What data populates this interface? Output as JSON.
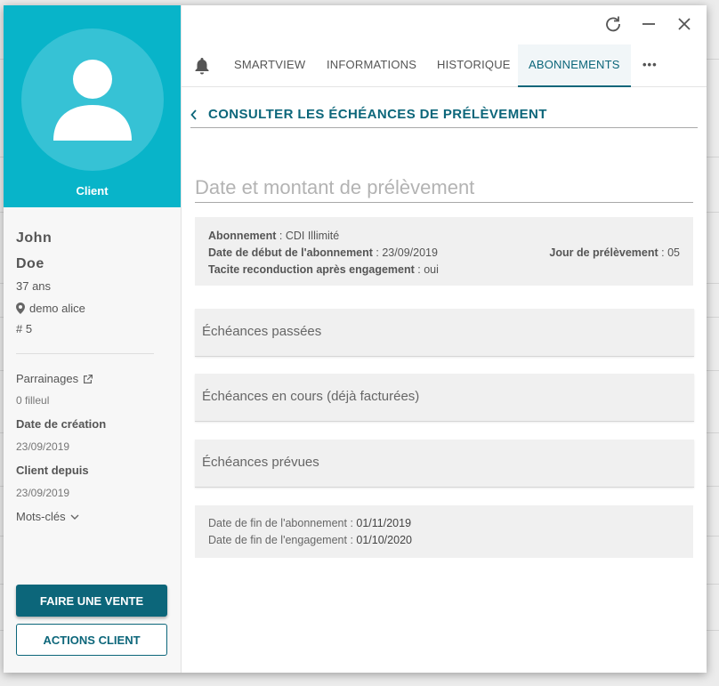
{
  "window_controls": {
    "refresh_icon": "refresh-icon",
    "minimize_icon": "minimize-icon",
    "close_icon": "close-icon"
  },
  "client_card": {
    "role_label": "Client",
    "first_name": "John",
    "last_name": "Doe",
    "age": "37 ans",
    "location": "demo alice",
    "id": "# 5",
    "referrals_label": "Parrainages",
    "referrals_value": "0 filleul",
    "creation_date_label": "Date de création",
    "creation_date_value": "23/09/2019",
    "client_since_label": "Client depuis",
    "client_since_value": "23/09/2019",
    "keywords_label": "Mots-clés"
  },
  "actions": {
    "primary": "FAIRE UNE VENTE",
    "secondary": "ACTIONS CLIENT"
  },
  "tabs": [
    {
      "label": "SMARTVIEW"
    },
    {
      "label": "INFORMATIONS"
    },
    {
      "label": "HISTORIQUE"
    },
    {
      "label": "ABONNEMENTS",
      "active": true
    },
    {
      "label": "•••"
    }
  ],
  "breadcrumb": "CONSULTER LES ÉCHÉANCES DE PRÉLÈVEMENT",
  "section_title": "Date et montant de prélèvement",
  "subscription": {
    "subscription_label": "Abonnement",
    "subscription_value": "CDI Illimité",
    "start_label": "Date de début de l'abonnement",
    "start_value": "23/09/2019",
    "day_label": "Jour de prélèvement",
    "day_value": "05",
    "renewal_label": "Tacite reconduction après engagement",
    "renewal_value": "oui"
  },
  "accordions": [
    {
      "label": "Échéances passées"
    },
    {
      "label": "Échéances en cours (déjà facturées)"
    },
    {
      "label": "Échéances prévues"
    }
  ],
  "end_dates": {
    "sub_end_label": "Date de fin de l'abonnement",
    "sub_end_value": "01/11/2019",
    "commit_end_label": "Date de fin de l'engagement",
    "commit_end_value": "01/10/2020"
  },
  "colors": {
    "accent": "#08b4c9",
    "primary": "#0c667a"
  }
}
